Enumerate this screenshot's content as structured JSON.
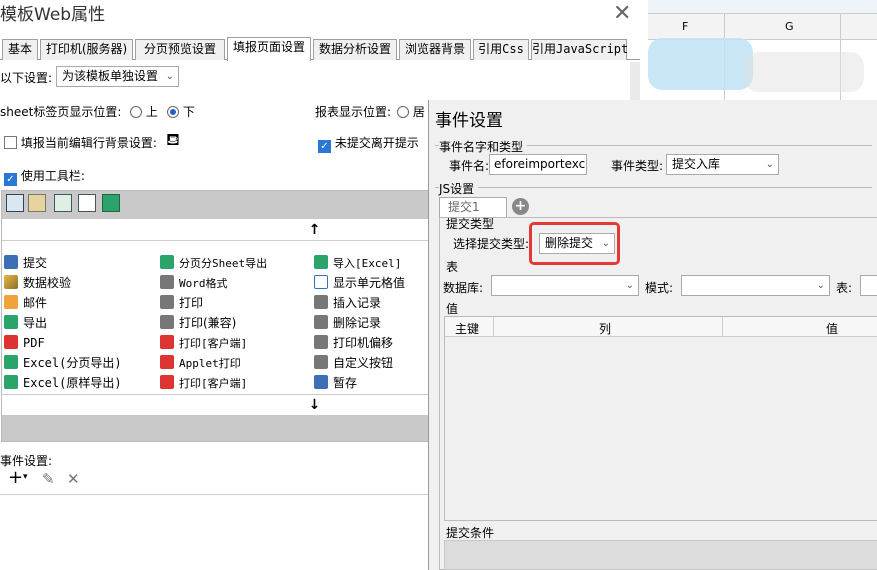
{
  "main_window": {
    "title": "模板Web属性",
    "tabs": [
      "基本",
      "打印机(服务器)",
      "分页预览设置",
      "填报页面设置",
      "数据分析设置",
      "浏览器背景",
      "引用Css",
      "引用JavaScript"
    ],
    "active_tab": "填报页面设置",
    "settings_label": "以下设置:",
    "settings_value": "为该模板单独设置",
    "sheet_pos_label": "sheet标签页显示位置:",
    "sheet_pos_top": "上",
    "sheet_pos_bottom": "下",
    "report_pos_label": "报表显示位置:",
    "report_pos_option": "居",
    "edit_bg_label": "填报当前编辑行背景设置:",
    "unsubmitted_label": "未提交离开提示",
    "use_toolbar_label": "使用工具栏:",
    "up_arrow": "↑",
    "down_arrow": "↓",
    "toolbar_items": [
      [
        "提交",
        "分页分Sheet导出",
        "导入[Excel]"
      ],
      [
        "数据校验",
        "Word格式",
        "显示单元格值"
      ],
      [
        "邮件",
        "打印",
        "插入记录"
      ],
      [
        "导出",
        "打印(兼容)",
        "删除记录"
      ],
      [
        "PDF",
        "打印[客户端]",
        "打印机偏移"
      ],
      [
        "Excel(分页导出)",
        "Applet打印",
        "自定义按钮"
      ],
      [
        "Excel(原样导出)",
        "打印[客户端]",
        "暂存"
      ]
    ],
    "event_settings_label": "事件设置:",
    "add_symbol": "+",
    "edit_symbol": "✎",
    "delete_symbol": "✕"
  },
  "event_dialog": {
    "title": "事件设置",
    "group_name_type": "事件名字和类型",
    "event_name_label": "事件名:",
    "event_name_value": "eforeimportexcel",
    "event_type_label": "事件类型:",
    "event_type_value": "提交入库",
    "js_group": "JS设置",
    "js_tab": "提交1",
    "submit_type_group": "提交类型",
    "select_submit_type_label": "选择提交类型:",
    "select_submit_type_value": "删除提交",
    "table_group": "表",
    "database_label": "数据库:",
    "schema_label": "模式:",
    "table_label": "表:",
    "value_group": "值",
    "columns": [
      "主键",
      "列",
      "值"
    ],
    "submit_condition_label": "提交条件"
  },
  "spreadsheet": {
    "col_f": "F",
    "col_g": "G"
  },
  "colors": {
    "highlight": "#e53935",
    "accent": "#1f5fd0"
  }
}
